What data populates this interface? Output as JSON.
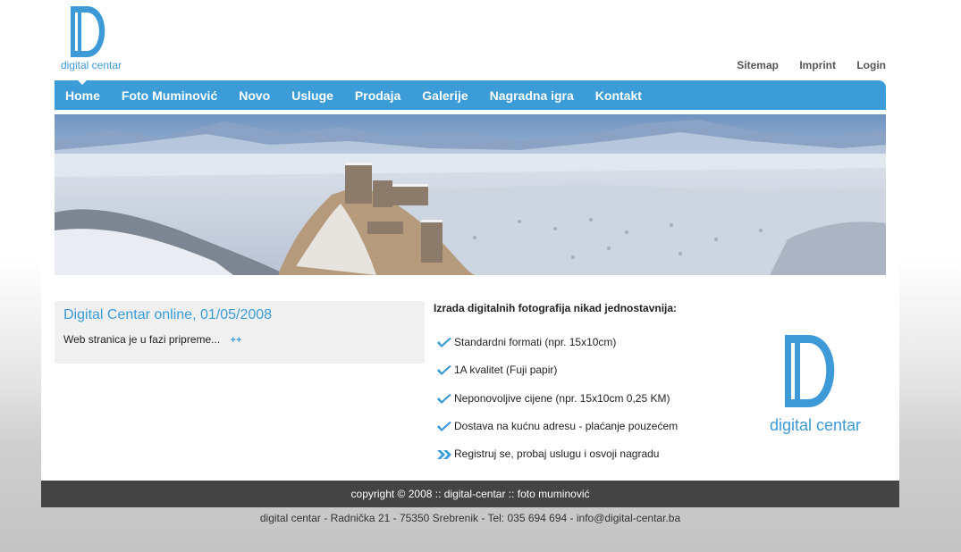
{
  "logo": {
    "text": "digital centar"
  },
  "toplinks": [
    "Sitemap",
    "Imprint",
    "Login"
  ],
  "nav": [
    "Home",
    "Foto Muminović",
    "Novo",
    "Usluge",
    "Prodaja",
    "Galerije",
    "Nagradna igra",
    "Kontakt"
  ],
  "news": {
    "title": "Digital Centar online, 01/05/2008",
    "text": "Web stranica je u fazi pripreme...",
    "more": "++"
  },
  "features": {
    "title": "Izrada digitalnih fotografija nikad jednostavnija:",
    "items": [
      "Standardni formati (npr. 15x10cm)",
      "1A kvalitet (Fuji papir)",
      "Neponovoljive cijene (npr. 15x10cm 0,25 KM)",
      "Dostava na kućnu adresu - plaćanje pouzećem",
      "Registruj se, probaj uslugu i osvoji nagradu"
    ]
  },
  "right_logo": {
    "text": "digital centar"
  },
  "footer": {
    "copyright": "copyright © 2008 :: digital-centar :: foto muminović",
    "address": "digital centar - Radnička 21 - 75350 Srebrenik - Tel: 035 694 694 - info@digital-centar.ba"
  },
  "colors": {
    "accent": "#3b9cd8",
    "footer": "#444444"
  }
}
